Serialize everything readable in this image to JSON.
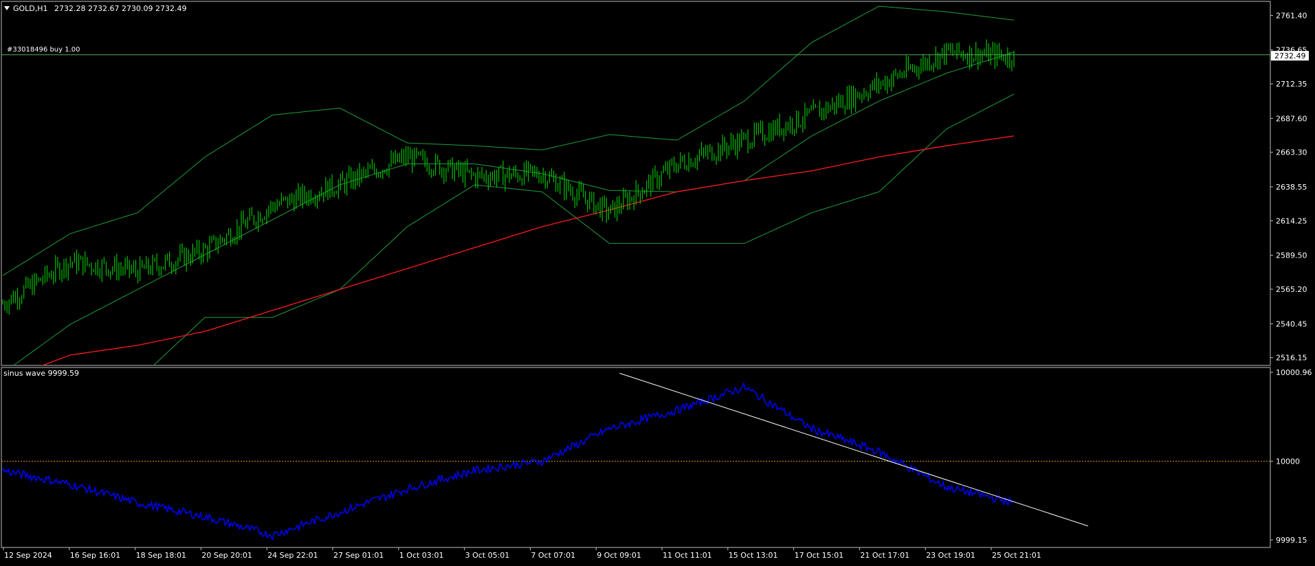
{
  "main": {
    "symbol": "GOLD,H1",
    "ohlc": "2732.28 2732.67 2730.09 2732.49",
    "order_label": "#33018496 buy 1.00",
    "current_price": "2732.49"
  },
  "indicator": {
    "label": "sinus wave 9999.59"
  },
  "colors": {
    "candles": "#00c000",
    "bollinger": "#1f9e3a",
    "ma": "#ff1a1a",
    "order_line": "#55b055",
    "price_badge_bg": "#ffffff",
    "wave": "#0000ff",
    "level_line": "#d4a017",
    "trend_line": "#ffffff",
    "axis_text": "#ffffff",
    "frame": "#c0c0c0"
  },
  "chart_data": [
    {
      "type": "candlestick",
      "title": "GOLD,H1",
      "grid": false,
      "ylim": [
        2500,
        2775
      ],
      "y_ticks": [
        "2761.40",
        "2736.65",
        "2712.35",
        "2687.60",
        "2663.30",
        "2638.55",
        "2614.25",
        "2589.50",
        "2565.20",
        "2540.45",
        "2516.15"
      ],
      "x_ticks": [
        "12 Sep 2024",
        "16 Sep 16:01",
        "18 Sep 18:01",
        "20 Sep 20:01",
        "24 Sep 22:01",
        "27 Sep 01:01",
        "1 Oct 03:01",
        "3 Oct 05:01",
        "7 Oct 07:01",
        "9 Oct 09:01",
        "11 Oct 11:01",
        "15 Oct 13:01",
        "17 Oct 15:01",
        "21 Oct 17:01",
        "23 Oct 19:01",
        "25 Oct 21:01"
      ],
      "series": [
        {
          "name": "Close",
          "x": [
            0,
            1,
            2,
            3,
            4,
            5,
            6,
            7,
            8,
            9,
            10,
            11,
            12,
            13,
            14,
            15
          ],
          "values": [
            2555,
            2585,
            2578,
            2593,
            2625,
            2640,
            2660,
            2646,
            2648,
            2620,
            2655,
            2672,
            2690,
            2712,
            2735,
            2732
          ]
        },
        {
          "name": "Upper band",
          "x": [
            0,
            1,
            2,
            3,
            4,
            5,
            6,
            7,
            8,
            9,
            10,
            11,
            12,
            13,
            14,
            15
          ],
          "values": [
            2575,
            2605,
            2620,
            2660,
            2690,
            2695,
            2670,
            2668,
            2665,
            2676,
            2672,
            2700,
            2742,
            2768,
            2764,
            2758
          ]
        },
        {
          "name": "Lower band",
          "x": [
            0,
            1,
            2,
            3,
            4,
            5,
            6,
            7,
            8,
            9,
            10,
            11,
            12,
            13,
            14,
            15
          ],
          "values": [
            2490,
            2480,
            2500,
            2545,
            2545,
            2565,
            2610,
            2640,
            2635,
            2598,
            2598,
            2598,
            2620,
            2635,
            2680,
            2705
          ]
        },
        {
          "name": "Middle band",
          "x": [
            0,
            1,
            2,
            3,
            4,
            5,
            6,
            7,
            8,
            9,
            10,
            11,
            12,
            13,
            14,
            15
          ],
          "values": [
            2505,
            2540,
            2565,
            2590,
            2615,
            2640,
            2655,
            2655,
            2648,
            2636,
            2635,
            2643,
            2675,
            2700,
            2720,
            2735
          ]
        },
        {
          "name": "Moving average",
          "x": [
            0,
            1,
            2,
            3,
            4,
            5,
            6,
            7,
            8,
            9,
            10,
            11,
            12,
            13,
            14,
            15
          ],
          "values": [
            2500,
            2518,
            2525,
            2535,
            2550,
            2565,
            2580,
            2595,
            2610,
            2622,
            2635,
            2643,
            2650,
            2660,
            2668,
            2675
          ]
        }
      ],
      "order_level": 2733.2
    },
    {
      "type": "line",
      "title": "sinus wave 9999.59",
      "grid": false,
      "ylim": [
        9999.15,
        10001.05
      ],
      "y_ticks": [
        "10000.96",
        "10000",
        "9999.15"
      ],
      "level": 10000,
      "series": [
        {
          "name": "sinus wave",
          "x": [
            0,
            1,
            2,
            3,
            4,
            5,
            6,
            7,
            8,
            9,
            10,
            11,
            12,
            13,
            14,
            15
          ],
          "values": [
            9999.9,
            9999.75,
            9999.55,
            9999.4,
            9999.2,
            9999.45,
            9999.7,
            9999.9,
            10000.0,
            10000.35,
            10000.55,
            10000.8,
            10000.35,
            10000.1,
            9999.72,
            9999.55
          ]
        }
      ],
      "trend_line": {
        "x0": 9.15,
        "y0": 10000.95,
        "x1": 16.1,
        "y1": 9999.3
      }
    }
  ]
}
